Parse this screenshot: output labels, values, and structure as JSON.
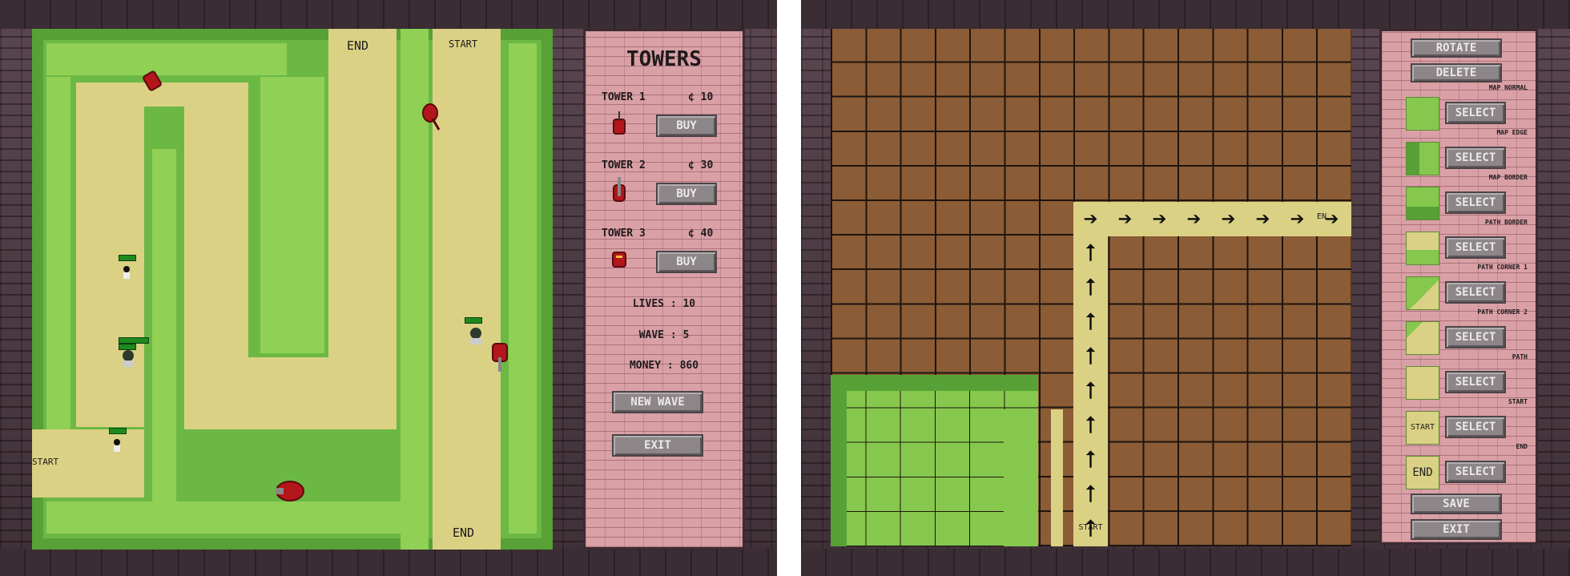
{
  "game": {
    "shop": {
      "title": "TOWERS",
      "towers": [
        {
          "name": "TOWER 1",
          "price": "¢ 10",
          "buy_label": "BUY"
        },
        {
          "name": "TOWER 2",
          "price": "¢ 30",
          "buy_label": "BUY"
        },
        {
          "name": "TOWER 3",
          "price": "¢ 40",
          "buy_label": "BUY"
        }
      ],
      "lives": "LIVES : 10",
      "wave": "WAVE : 5",
      "money": "MONEY : 860",
      "new_wave_label": "NEW WAVE",
      "exit_label": "EXIT"
    },
    "map_labels": {
      "end_top": "END",
      "start_top": "START",
      "start_left": "START",
      "end_bottom": "END"
    }
  },
  "editor": {
    "rotate_label": "ROTATE",
    "delete_label": "DELETE",
    "tiles": [
      {
        "caption": "MAP NORMAL",
        "select_label": "SELECT"
      },
      {
        "caption": "MAP EDGE",
        "select_label": "SELECT"
      },
      {
        "caption": "MAP BORDER",
        "select_label": "SELECT"
      },
      {
        "caption": "PATH BORDER",
        "select_label": "SELECT"
      },
      {
        "caption": "PATH CORNER 1",
        "select_label": "SELECT"
      },
      {
        "caption": "PATH CORNER 2",
        "select_label": "SELECT"
      },
      {
        "caption": "PATH",
        "select_label": "SELECT"
      },
      {
        "caption": "START",
        "select_label": "SELECT",
        "thumb_text": "START"
      },
      {
        "caption": "END",
        "select_label": "SELECT",
        "thumb_text": "END"
      }
    ],
    "save_label": "SAVE",
    "exit_label": "EXIT",
    "grid_start_label": "START",
    "arrow_glyph_up": "⭡",
    "arrow_glyph_right": "➔",
    "end_marker": "EN"
  },
  "colors": {
    "grass": "#6cb845",
    "grass_inner": "#8fd055",
    "path": "#dbd184",
    "dirt": "#8b5c35",
    "panel_brick": "#d9a0a6",
    "tower_red": "#b3161b"
  }
}
